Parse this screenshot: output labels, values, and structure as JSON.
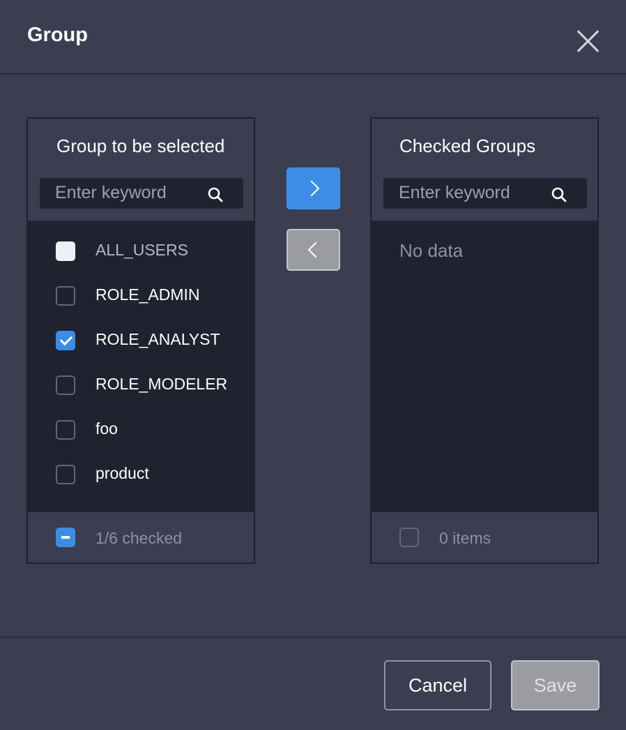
{
  "dialog": {
    "title": "Group"
  },
  "source": {
    "title": "Group to be selected",
    "search_placeholder": "Enter keyword",
    "items": [
      {
        "label": "ALL_USERS",
        "state": "disabled"
      },
      {
        "label": "ROLE_ADMIN",
        "state": "unchecked"
      },
      {
        "label": "ROLE_ANALYST",
        "state": "checked"
      },
      {
        "label": "ROLE_MODELER",
        "state": "unchecked"
      },
      {
        "label": "foo",
        "state": "unchecked"
      },
      {
        "label": "product",
        "state": "unchecked"
      }
    ],
    "footer_text": "1/6 checked",
    "footer_state": "indeterminate"
  },
  "target": {
    "title": "Checked Groups",
    "search_placeholder": "Enter keyword",
    "empty_text": "No data",
    "footer_text": "0 items",
    "footer_state": "unchecked"
  },
  "transfer": {
    "to_right_icon": "chevron-right-icon",
    "to_left_icon": "chevron-left-icon"
  },
  "actions": {
    "cancel_label": "Cancel",
    "save_label": "Save"
  },
  "colors": {
    "background": "#3a3e50",
    "list_background": "#20232f",
    "accent": "#3b8de6",
    "disabled_button": "#9a9ca1"
  }
}
